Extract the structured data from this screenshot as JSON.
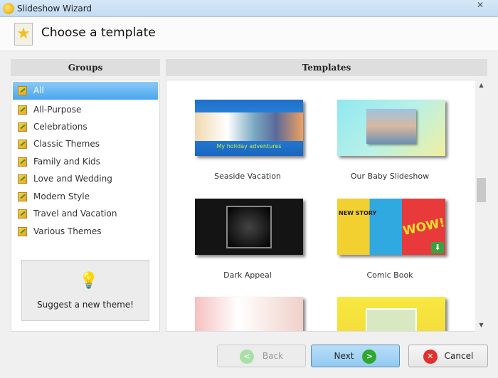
{
  "window": {
    "title": "Slideshow Wizard",
    "close": "✕"
  },
  "header": {
    "title": "Choose a template"
  },
  "groups": {
    "heading": "Groups",
    "items": [
      "All",
      "All-Purpose",
      "Celebrations",
      "Classic Themes",
      "Family and Kids",
      "Love and Wedding",
      "Modern Style",
      "Travel and Vacation",
      "Various Themes"
    ],
    "selected": "All",
    "suggest_label": "Suggest a new theme!"
  },
  "templates": {
    "heading": "Templates",
    "items": [
      {
        "name": "Seaside Vacation",
        "caption": "My holiday adventures"
      },
      {
        "name": "Our Baby Slideshow"
      },
      {
        "name": "Dark Appeal"
      },
      {
        "name": "Comic Book",
        "comic_text": "WOW!",
        "comic_sub": "NEW STORY"
      }
    ]
  },
  "buttons": {
    "back": "Back",
    "next": "Next",
    "cancel": "Cancel"
  },
  "colors": {
    "selected": "#4aa6ee",
    "next": "#9fd0f5"
  }
}
